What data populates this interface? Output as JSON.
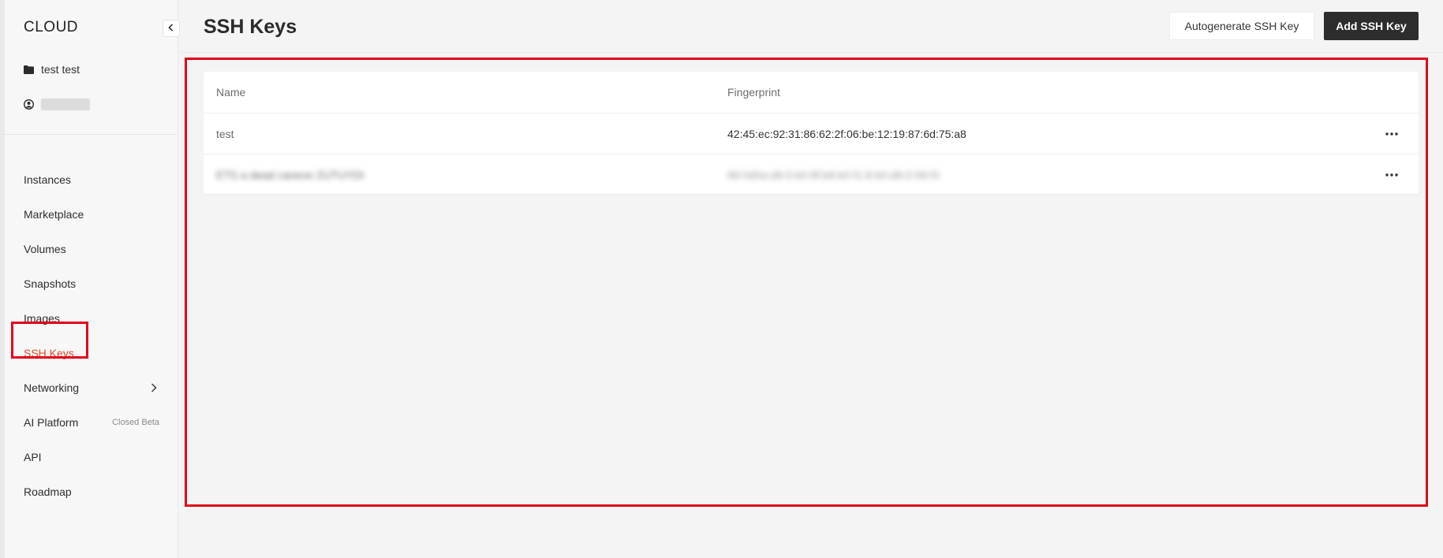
{
  "app": {
    "brand": "CLOUD"
  },
  "sidebar": {
    "project_name": "test test",
    "account_name": "",
    "items": [
      {
        "label": "Instances"
      },
      {
        "label": "Marketplace"
      },
      {
        "label": "Volumes"
      },
      {
        "label": "Snapshots"
      },
      {
        "label": "Images"
      },
      {
        "label": "SSH Keys",
        "active": true
      },
      {
        "label": "Networking",
        "has_submenu": true
      },
      {
        "label": "AI Platform",
        "badge": "Closed Beta"
      },
      {
        "label": "API"
      },
      {
        "label": "Roadmap"
      }
    ]
  },
  "header": {
    "title": "SSH Keys",
    "autogenerate_label": "Autogenerate SSH Key",
    "add_label": "Add SSH Key"
  },
  "table": {
    "columns": [
      "Name",
      "Fingerprint"
    ],
    "rows": [
      {
        "name": "test",
        "fingerprint": "42:45:ec:92:31:86:62:2f:06:be:12:19:87:6d:75:a8"
      },
      {
        "name": "ETS a dead caneve ZUTUYDI",
        "fingerprint": "88:0d5a:d8:5:b0:8f:b8:b0:f1:8:b0:d6:0:58:f3"
      }
    ]
  },
  "colors": {
    "accent": "#e8472e",
    "highlight_frame": "#e2061a",
    "primary_button": "#2d2d2d"
  }
}
